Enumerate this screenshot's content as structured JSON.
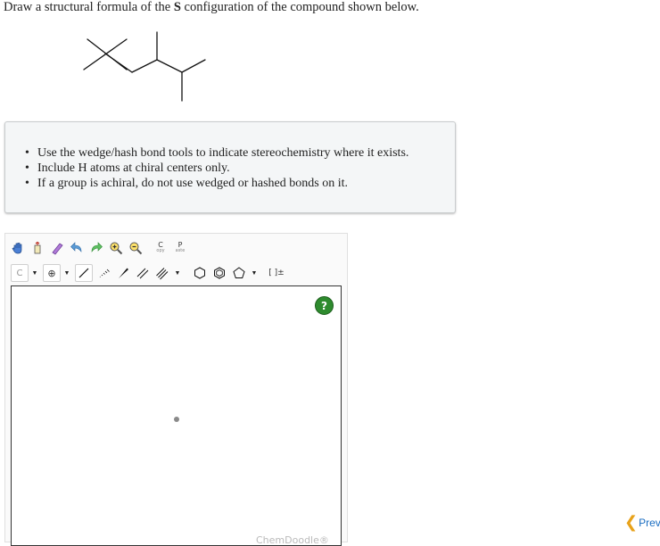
{
  "question": {
    "before": "Draw a structural formula of the ",
    "bold": "S",
    "after": " configuration of the compound shown below."
  },
  "hints": [
    "Use the wedge/hash bond tools to indicate stereochemistry where it exists.",
    "Include H atoms at chiral centers only.",
    "If a group is achiral, do not use wedged or hashed bonds on it."
  ],
  "toolbar": {
    "row1": [
      {
        "name": "hand-icon",
        "kind": "icon"
      },
      {
        "name": "lasso-icon",
        "kind": "icon"
      },
      {
        "name": "eraser-icon",
        "kind": "icon"
      },
      {
        "name": "undo-icon",
        "kind": "icon"
      },
      {
        "name": "redo-icon",
        "kind": "icon"
      },
      {
        "name": "zoom-in-icon",
        "kind": "icon"
      },
      {
        "name": "zoom-out-icon",
        "kind": "icon"
      }
    ],
    "copy_label_top": "C",
    "copy_label_bottom": "opy",
    "paste_label_top": "P",
    "paste_label_bottom": "aste",
    "atom_label": "C",
    "charge_label": "⊕",
    "bracket_label": "[ ]±"
  },
  "canvas": {
    "help_label": "?",
    "watermark": "ChemDoodle®"
  },
  "nav": {
    "prev_label": "Previ"
  },
  "colors": {
    "help_green": "#2e8b2e",
    "prev_chevron": "#e8a21a",
    "prev_text": "#1b6ec2"
  }
}
